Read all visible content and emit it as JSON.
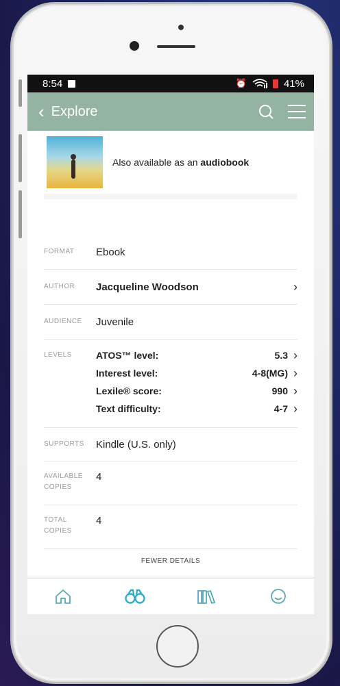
{
  "status": {
    "time": "8:54",
    "battery": "41%"
  },
  "topbar": {
    "back_label": "Explore"
  },
  "audiobook": {
    "prefix": "Also available as an ",
    "emphasis": "audiobook"
  },
  "details": {
    "format": {
      "label": "FORMAT",
      "value": "Ebook"
    },
    "author": {
      "label": "AUTHOR",
      "value": "Jacqueline Woodson"
    },
    "audience": {
      "label": "AUDIENCE",
      "value": "Juvenile"
    },
    "levels": {
      "label": "LEVELS",
      "items": [
        {
          "name": "ATOS™ level:",
          "value": "5.3"
        },
        {
          "name": "Interest level:",
          "value": "4-8(MG)"
        },
        {
          "name": "Lexile® score:",
          "value": "990"
        },
        {
          "name": "Text difficulty:",
          "value": "4-7"
        }
      ]
    },
    "supports": {
      "label": "SUPPORTS",
      "value": "Kindle (U.S. only)"
    },
    "available": {
      "label_1": "AVAILABLE",
      "label_2": "COPIES",
      "value": "4"
    },
    "total": {
      "label_1": "TOTAL",
      "label_2": "COPIES",
      "value": "4"
    }
  },
  "fewer_details": "FEWER DETAILS",
  "colors": {
    "header": "#95b3a2",
    "nav_active": "#2fb0c8",
    "nav_inactive": "#5aa9b6"
  },
  "nav": {
    "items": [
      {
        "icon": "home-icon"
      },
      {
        "icon": "binoculars-icon",
        "active": true
      },
      {
        "icon": "library-icon"
      },
      {
        "icon": "smiley-icon"
      }
    ]
  }
}
